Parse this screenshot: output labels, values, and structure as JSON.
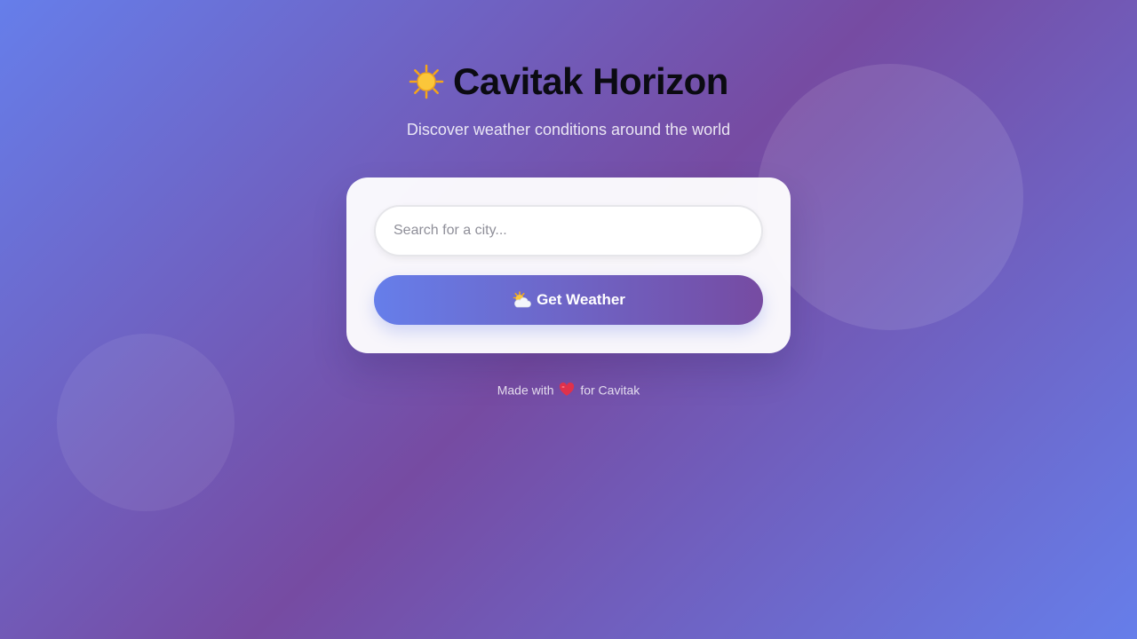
{
  "header": {
    "title": "Cavitak Horizon",
    "title_icon": "sun-icon",
    "subtitle": "Discover weather conditions around the world"
  },
  "search": {
    "value": "",
    "placeholder": "Search for a city..."
  },
  "button": {
    "label": "Get Weather",
    "icon": "sun-behind-cloud-icon"
  },
  "footer": {
    "prefix": "Made with",
    "icon": "heart-icon",
    "suffix": "for Cavitak"
  },
  "colors": {
    "gradient_start": "#667eea",
    "gradient_end": "#764ba2",
    "heart": "#e0314b",
    "sun": "#f9c21a"
  }
}
